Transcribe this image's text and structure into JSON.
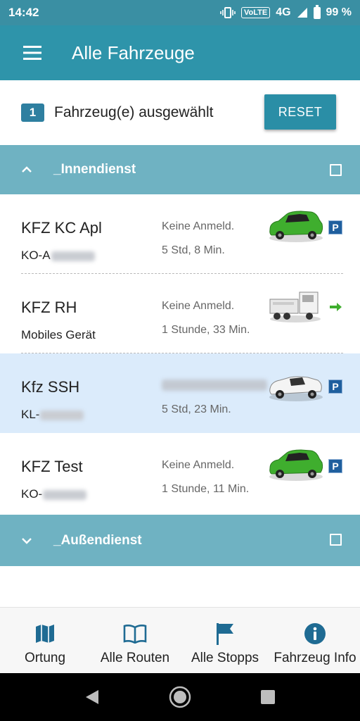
{
  "status_bar": {
    "time": "14:42",
    "network": "4G",
    "volte": "VoLTE",
    "battery": "99 %"
  },
  "app_bar": {
    "title": "Alle Fahrzeuge"
  },
  "selection": {
    "count": "1",
    "text": "Fahrzeug(e) ausgewählt",
    "reset_label": "RESET"
  },
  "groups": [
    {
      "name": "_Innendienst",
      "expanded": true,
      "vehicles": [
        {
          "name": "KFZ KC Apl",
          "sub": "KO-A",
          "status": "Keine Anmeld.",
          "time": "5 Std, 8 Min.",
          "vehicle_icon": "green-car-icon",
          "state_icon": "parking-icon",
          "selected": false
        },
        {
          "name": "KFZ RH",
          "sub": "Mobiles Gerät",
          "status": "Keine Anmeld.",
          "time": "1 Stunde, 33 Min.",
          "vehicle_icon": "white-truck-icon",
          "state_icon": "arrow-right-icon",
          "selected": false
        },
        {
          "name": "Kfz SSH",
          "sub": "KL-",
          "status": "",
          "time": "5 Std, 23 Min.",
          "vehicle_icon": "white-convertible-icon",
          "state_icon": "parking-icon",
          "selected": true
        },
        {
          "name": "KFZ Test",
          "sub": "KO-",
          "status": "Keine Anmeld.",
          "time": "1 Stunde, 11 Min.",
          "vehicle_icon": "green-car-icon",
          "state_icon": "parking-icon",
          "selected": false
        }
      ]
    },
    {
      "name": "_Außendienst",
      "expanded": false
    }
  ],
  "bottom_nav": [
    {
      "label": "Ortung",
      "icon": "map-icon"
    },
    {
      "label": "Alle Routen",
      "icon": "book-icon"
    },
    {
      "label": "Alle Stopps",
      "icon": "flag-icon"
    },
    {
      "label": "Fahrzeug Info",
      "icon": "info-icon"
    }
  ],
  "colors": {
    "primary": "#2e94aa",
    "group_header": "#6fb2c2",
    "selected_row": "#dbebfb",
    "icon_blue": "#1f6b93",
    "parking": "#1f5f9e"
  },
  "icons": {
    "state_parking_text": "P"
  }
}
